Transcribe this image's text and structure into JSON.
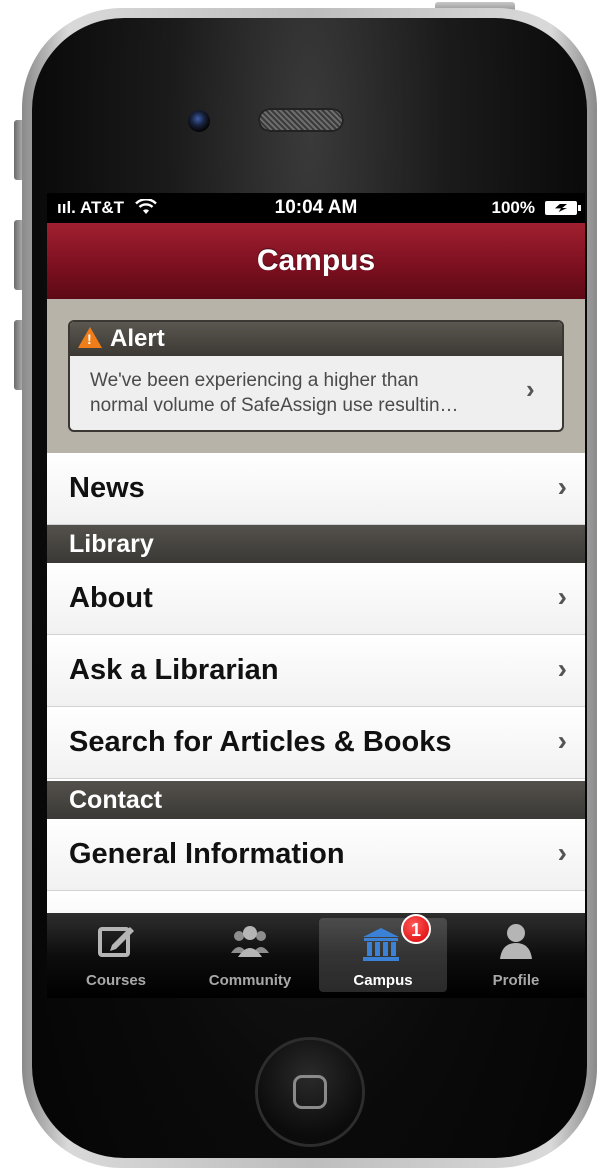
{
  "status_bar": {
    "carrier": "ııl. AT&T",
    "time": "10:04 AM",
    "battery": "100%"
  },
  "nav": {
    "title": "Campus"
  },
  "alert": {
    "title": "Alert",
    "line1": "We've been experiencing a higher than",
    "line2": "normal volume of SafeAssign use resultin…"
  },
  "list": {
    "news": "News",
    "library_header": "Library",
    "about": "About",
    "ask_librarian": "Ask a Librarian",
    "search_articles": "Search for Articles & Books",
    "contact_header": "Contact",
    "general_info": "General Information"
  },
  "tabs": [
    {
      "label": "Courses",
      "icon": "compose-icon"
    },
    {
      "label": "Community",
      "icon": "people-icon"
    },
    {
      "label": "Campus",
      "icon": "building-icon",
      "badge": "1",
      "active": true
    },
    {
      "label": "Profile",
      "icon": "person-icon"
    }
  ],
  "colors": {
    "nav_red": "#7d1020",
    "section_dark": "#3b3935",
    "alert_orange": "#ef7d1a",
    "tab_active_blue": "#3b82d6",
    "badge_red": "#d90000"
  }
}
